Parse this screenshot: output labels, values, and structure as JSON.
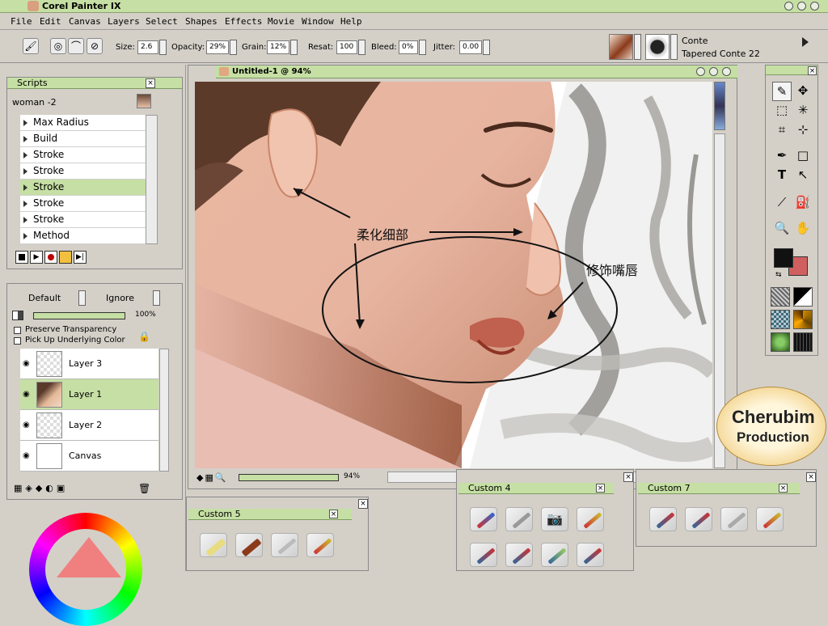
{
  "app": {
    "title": "Corel Painter IX"
  },
  "menu": [
    "File",
    "Edit",
    "Canvas",
    "Layers",
    "Select",
    "Shapes",
    "Effects",
    "Movie",
    "Window",
    "Help"
  ],
  "property_bar": {
    "size_label": "Size:",
    "size_value": "2.6",
    "opacity_label": "Opacity:",
    "opacity_value": "29%",
    "grain_label": "Grain:",
    "grain_value": "12%",
    "resat_label": "Resat:",
    "resat_value": "100",
    "bleed_label": "Bleed:",
    "bleed_value": "0%",
    "jitter_label": "Jitter:",
    "jitter_value": "0.00",
    "brush_category": "Conte",
    "brush_variant": "Tapered Conte 22"
  },
  "scripts_palette": {
    "title": "Scripts",
    "selected_script": "woman -2",
    "items": [
      {
        "label": "Max Radius",
        "selected": false
      },
      {
        "label": "Build",
        "selected": false
      },
      {
        "label": "Stroke",
        "selected": false
      },
      {
        "label": "Stroke",
        "selected": false
      },
      {
        "label": "Stroke",
        "selected": true
      },
      {
        "label": "Stroke",
        "selected": false
      },
      {
        "label": "Stroke",
        "selected": false
      },
      {
        "label": "Method",
        "selected": false
      }
    ]
  },
  "layers_palette": {
    "composite_method": "Default",
    "depth": "Ignore",
    "opacity": "100%",
    "preserve_transparency": "Preserve Transparency",
    "pick_up_underlying": "Pick Up Underlying Color",
    "layers": [
      {
        "name": "Layer 3",
        "selected": false
      },
      {
        "name": "Layer 1",
        "selected": true
      },
      {
        "name": "Layer 2",
        "selected": false
      },
      {
        "name": "Canvas",
        "selected": false
      }
    ]
  },
  "document": {
    "title": "Untitled-1 @ 94%",
    "zoom": "94%",
    "annotation_soften": "柔化细部",
    "annotation_lips": "修饰嘴唇"
  },
  "custom_palettes": [
    {
      "title": "Custom 4"
    },
    {
      "title": "Custom 5"
    },
    {
      "title": "Custom 7"
    }
  ],
  "watermark": {
    "line1": "Cherubim",
    "line2": "Production"
  },
  "colors": {
    "accent": "#c6dfa4",
    "primary_color": "#111111",
    "secondary_color": "#d06060"
  }
}
